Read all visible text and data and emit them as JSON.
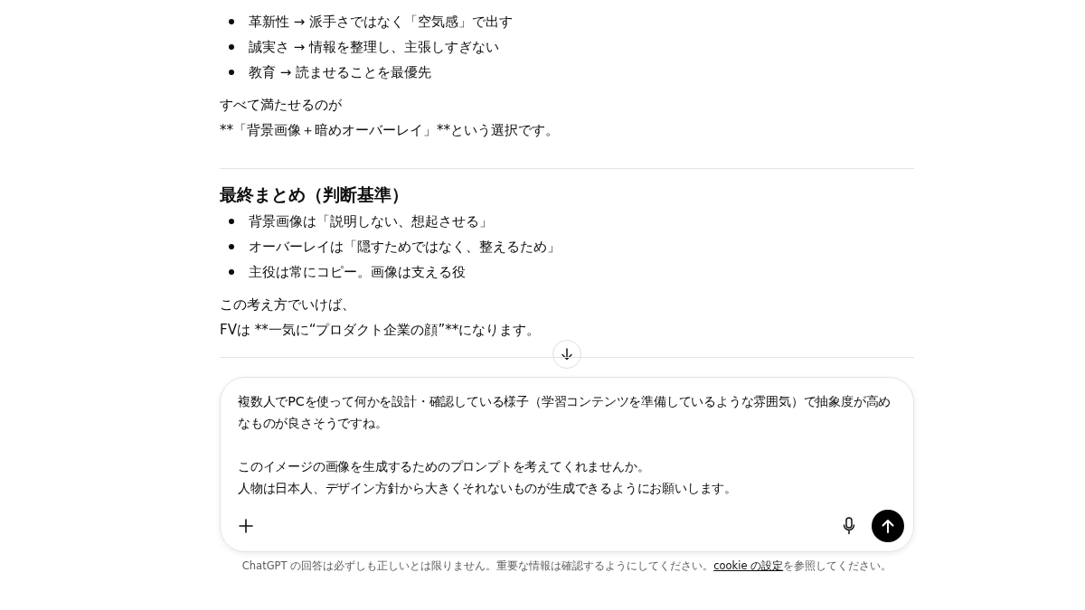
{
  "thread": [
    {
      "kind": "list",
      "items": [
        "革新性 → 派手さではなく「空気感」で出す",
        "誠実さ → 情報を整理し、主張しすぎない",
        "教育 → 読ませることを最優先"
      ]
    },
    {
      "kind": "paragraph",
      "lines": [
        "すべて満たせるのが",
        "**「背景画像＋暗めオーバーレイ」**という選択です。"
      ]
    },
    {
      "kind": "divider"
    },
    {
      "kind": "heading",
      "text": "最終まとめ（判断基準）"
    },
    {
      "kind": "list",
      "items": [
        "背景画像は「説明しない、想起させる」",
        "オーバーレイは「隠すためではなく、整えるため」",
        "主役は常にコピー。画像は支える役"
      ]
    },
    {
      "kind": "paragraph",
      "lines": [
        "この考え方でいけば、",
        "FVは **一気に“プロダクト企業の顔”**になります。"
      ]
    }
  ],
  "composer": {
    "paragraphs": [
      [
        "複数人でPCを使って何かを設計・確認している様子（学習コンテンツを準備しているような雰囲気）で抽象度が高めなものが良さそうですね。"
      ],
      [
        "このイメージの画像を生成するためのプロンプトを考えてくれませんか。",
        "人物は日本人、デザイン方針から大きくそれないものが生成できるようにお願いします。"
      ]
    ]
  },
  "footer": {
    "before": "ChatGPT の回答は必ずしも正しいとは限りません。重要な情報は確認するようにしてください。",
    "link": "cookie の設定",
    "after": "を参照してください。"
  }
}
